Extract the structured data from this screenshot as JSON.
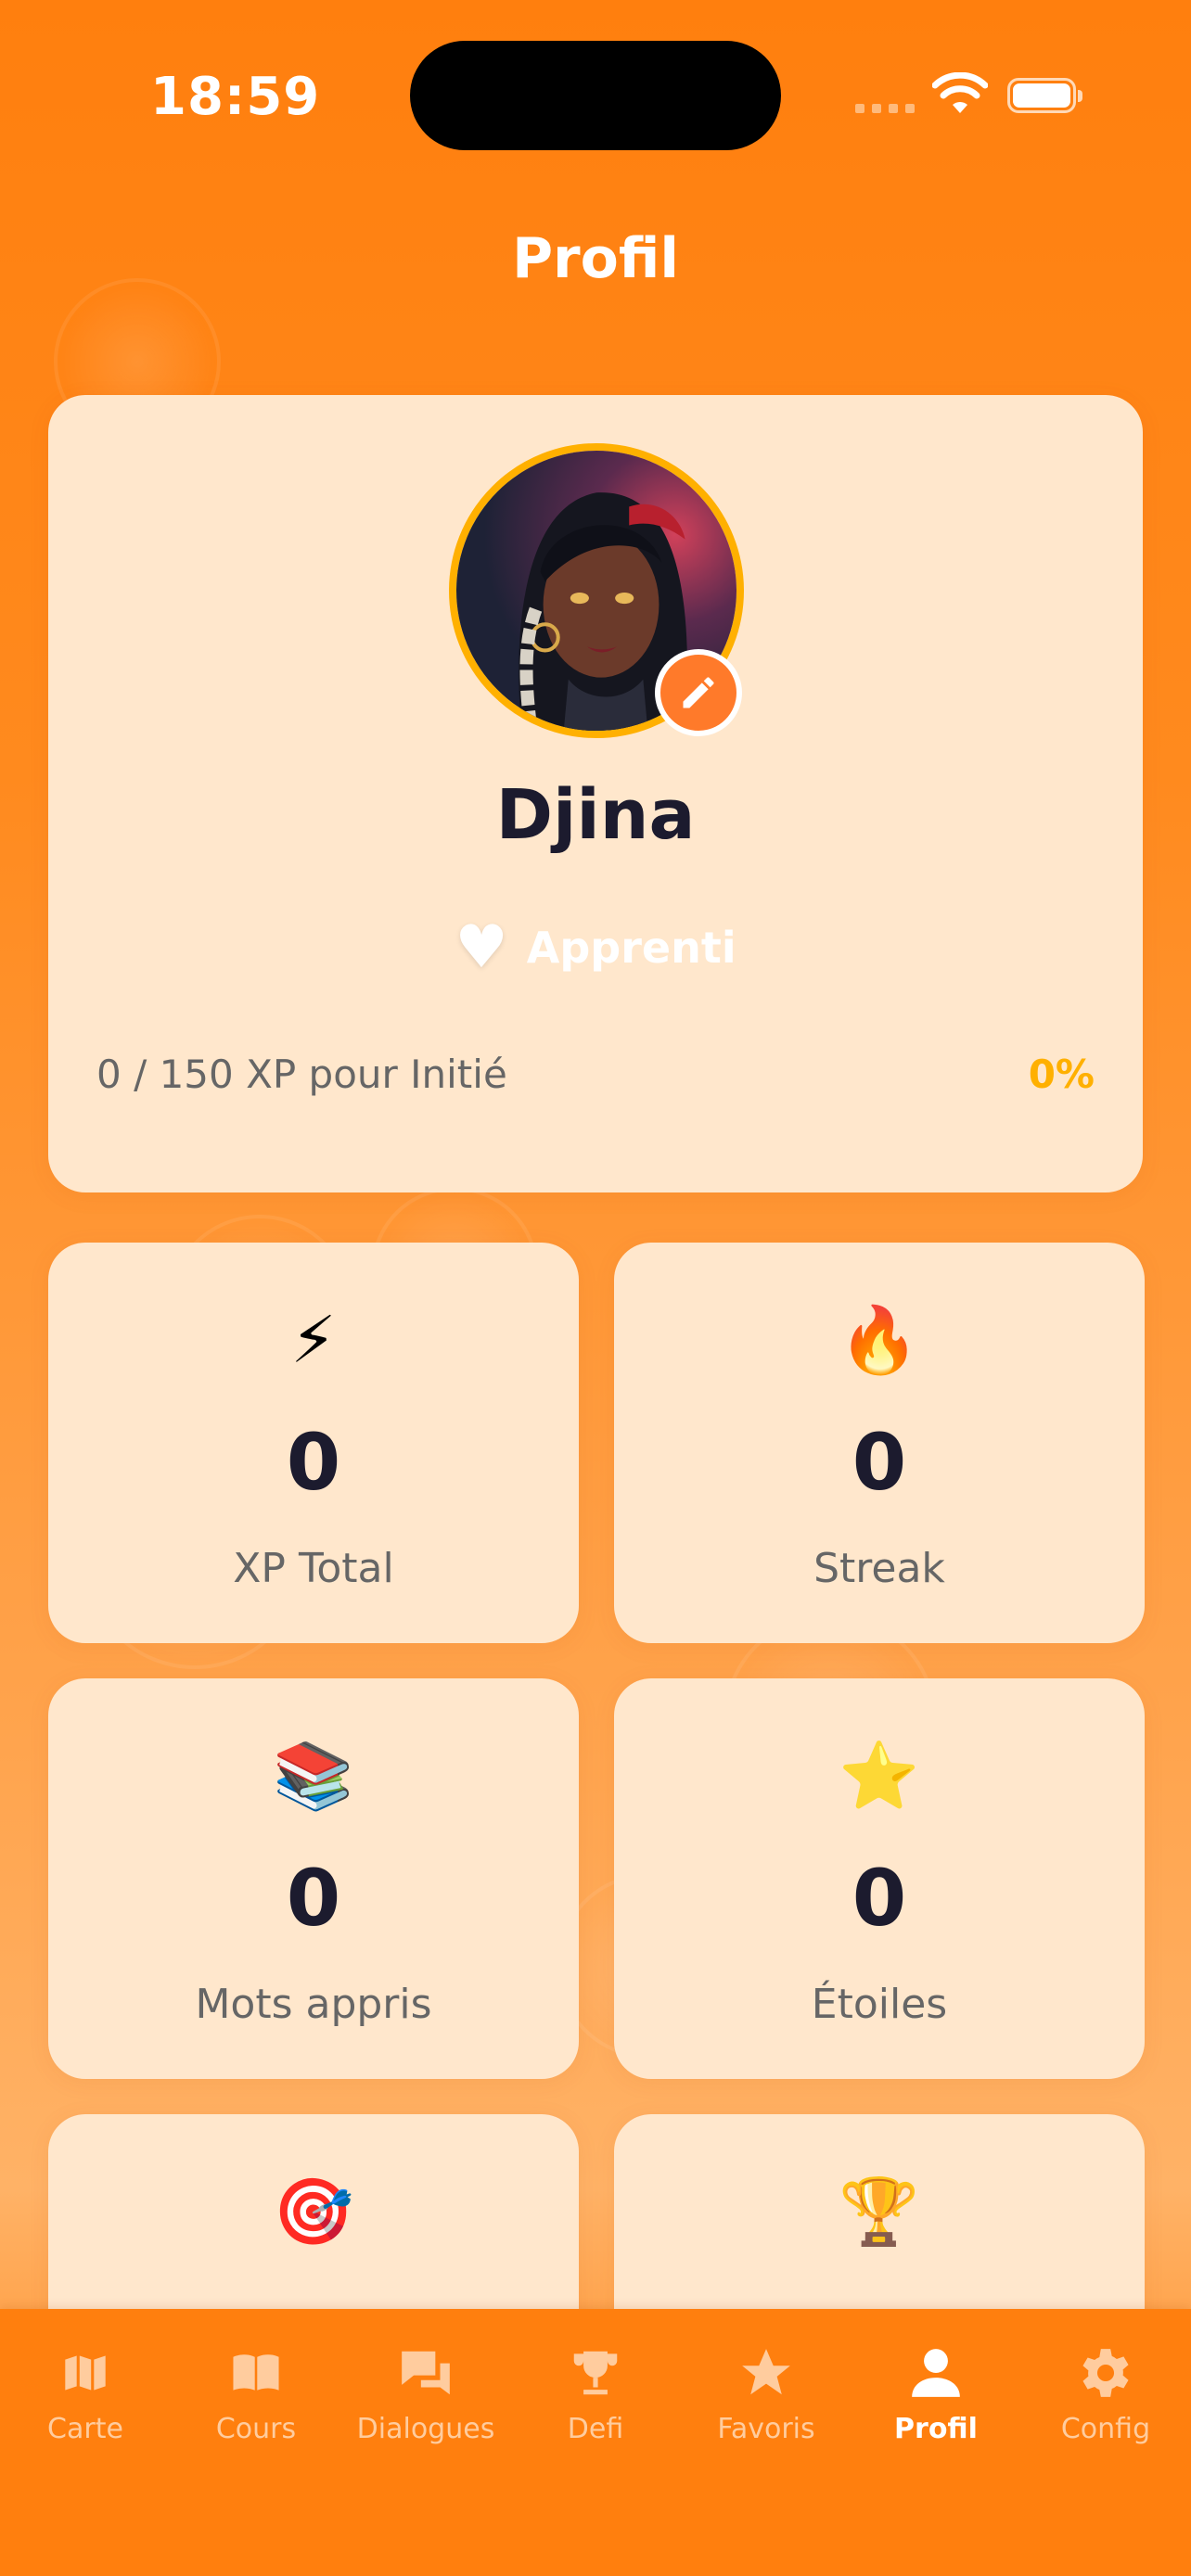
{
  "status_bar": {
    "time": "18:59"
  },
  "header": {
    "title": "Profil"
  },
  "profile": {
    "name": "Djina",
    "rank_icon": "white-heart",
    "rank": "Apprenti",
    "xp_progress": "0 / 150 XP pour Initié",
    "xp_percent": "0%",
    "xp_fraction": 0
  },
  "stats": [
    {
      "icon": "lightning-emoji",
      "glyph": "⚡",
      "value": "0",
      "label": "XP Total"
    },
    {
      "icon": "fire-emoji",
      "glyph": "🔥",
      "value": "0",
      "label": "Streak"
    },
    {
      "icon": "books-emoji",
      "glyph": "📚",
      "value": "0",
      "label": "Mots appris"
    },
    {
      "icon": "star-emoji",
      "glyph": "⭐",
      "value": "0",
      "label": "Étoiles"
    },
    {
      "icon": "target-emoji",
      "glyph": "🎯"
    },
    {
      "icon": "trophy-emoji",
      "glyph": "🏆"
    }
  ],
  "tabs": [
    {
      "label": "Carte",
      "icon": "map-icon"
    },
    {
      "label": "Cours",
      "icon": "book-icon"
    },
    {
      "label": "Dialogues",
      "icon": "chat-icon"
    },
    {
      "label": "Defi",
      "icon": "trophy-icon"
    },
    {
      "label": "Favoris",
      "icon": "star-icon"
    },
    {
      "label": "Profil",
      "icon": "person-icon",
      "active": true
    },
    {
      "label": "Config",
      "icon": "gear-icon"
    }
  ],
  "colors": {
    "background": "#FF7F0E",
    "card": "#FFE7CC",
    "accent": "#FFB000",
    "edit_button": "#FF7A2A",
    "text_dark": "#1C1B2E"
  }
}
